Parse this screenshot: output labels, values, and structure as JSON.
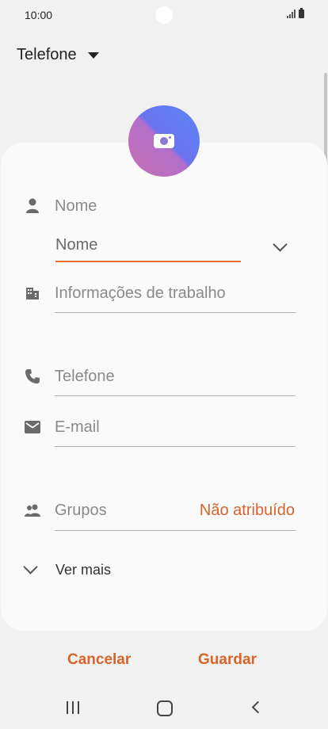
{
  "status_bar": {
    "time": "10:00"
  },
  "header": {
    "account_label": "Telefone"
  },
  "form": {
    "name_section_label": "Nome",
    "name_input_placeholder": "Nome",
    "work_info_placeholder": "Informações de trabalho",
    "phone_placeholder": "Telefone",
    "email_placeholder": "E-mail",
    "groups_label": "Grupos",
    "groups_value": "Não atribuído",
    "see_more_label": "Ver mais"
  },
  "footer": {
    "cancel_label": "Cancelar",
    "save_label": "Guardar"
  },
  "colors": {
    "accent": "#d7642a",
    "background": "#f1f1f1",
    "card": "#fafafa"
  },
  "icons": [
    "person-icon",
    "building-icon",
    "phone-icon",
    "email-icon",
    "group-icon",
    "camera-icon",
    "chevron-down-icon"
  ]
}
